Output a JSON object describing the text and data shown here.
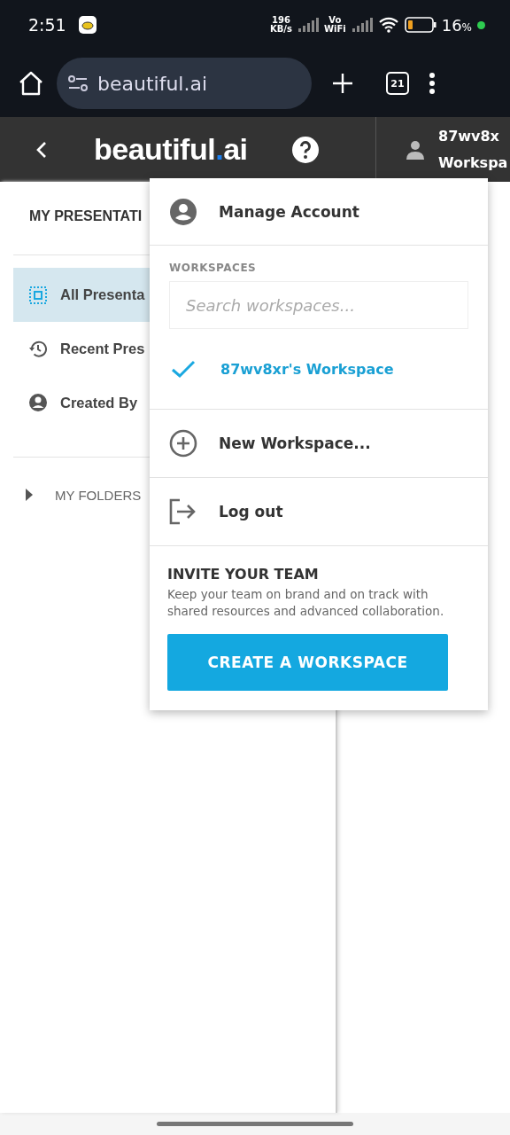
{
  "status_bar": {
    "time": "2:51",
    "net_speed": "196",
    "net_unit": "KB/s",
    "volte": "Vo",
    "volte_sub": "WiFi",
    "battery": "16",
    "battery_unit": "%"
  },
  "browser": {
    "url": "beautiful.ai",
    "tab_count": "21"
  },
  "header": {
    "logo_left": "beautiful",
    "logo_dot": ".",
    "logo_right": "ai",
    "user_line1": "87wv8x",
    "user_line2": "Workspa"
  },
  "sidebar": {
    "title": "MY PRESENTATI",
    "items": [
      {
        "kind": "all",
        "label": "All Presenta",
        "selected": true
      },
      {
        "kind": "recent",
        "label": "Recent Pres",
        "selected": false
      },
      {
        "kind": "created",
        "label": "Created By",
        "selected": false
      }
    ],
    "folders": {
      "label": "MY FOLDERS",
      "expanded": false
    }
  },
  "menu": {
    "manage": "Manage Account",
    "workspaces_heading": "WORKSPACES",
    "search": {
      "placeholder": "Search workspaces..."
    },
    "workspaces": [
      {
        "name": "87wv8xr's Workspace",
        "checked": true
      }
    ],
    "new_workspace": "New Workspace...",
    "logout": "Log out",
    "invite_title": "INVITE YOUR TEAM",
    "invite_text": "Keep your team on brand and on track with shared resources and advanced collaboration.",
    "create_button": "CREATE A WORKSPACE"
  }
}
